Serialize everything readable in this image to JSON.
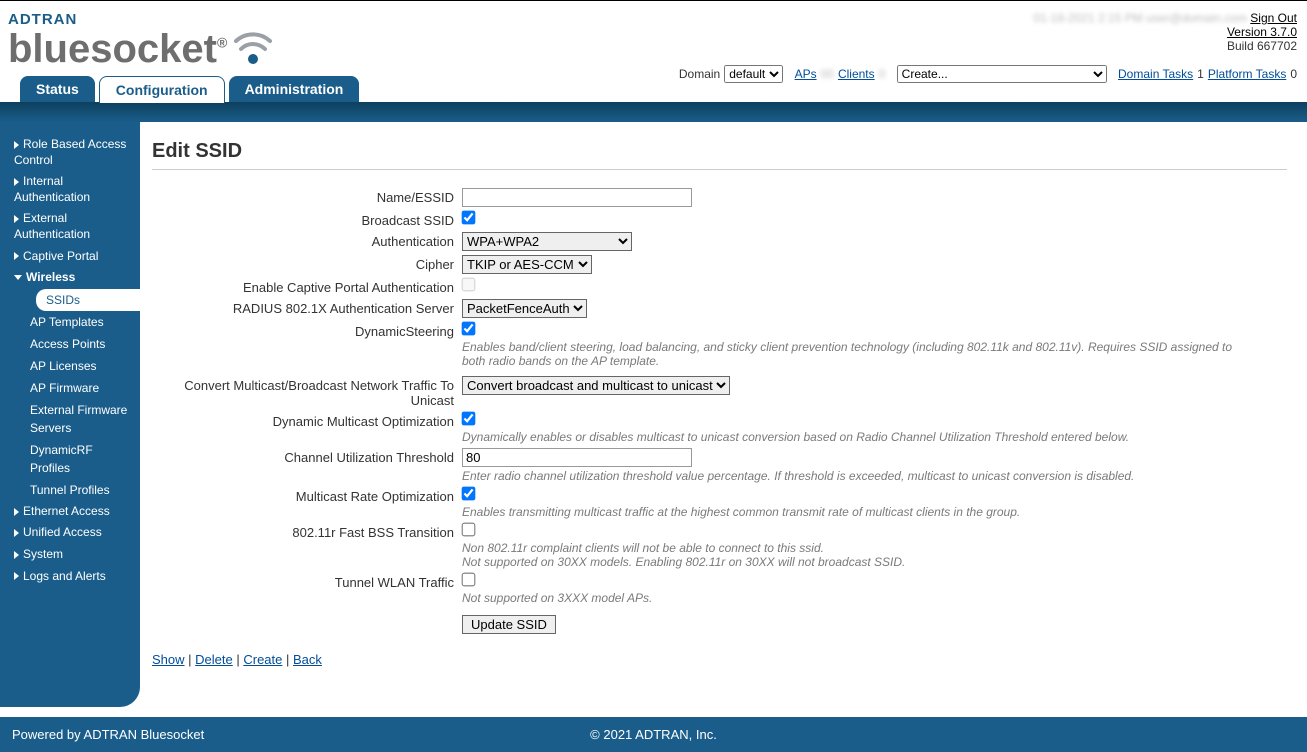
{
  "brand": {
    "line1": "ADTRAN",
    "line2": "bluesocket"
  },
  "top_right": {
    "obscured1": "01-18-2021 2:15 PM",
    "obscured2": "user@domain.com",
    "signout": "Sign Out",
    "version": "Version 3.7.0",
    "build": "Build 667702"
  },
  "subbar": {
    "domain_label": "Domain",
    "domain_value": "default",
    "aps_label": "APs",
    "aps_count": "",
    "clients_label": "Clients",
    "clients_count": "",
    "create_value": "Create...",
    "domain_tasks_label": "Domain Tasks",
    "domain_tasks_count": "1",
    "platform_tasks_label": "Platform Tasks",
    "platform_tasks_count": "0"
  },
  "tabs": {
    "status": "Status",
    "configuration": "Configuration",
    "administration": "Administration"
  },
  "sidebar": {
    "role": "Role Based Access Control",
    "internal": "Internal Authentication",
    "external": "External Authentication",
    "captive": "Captive Portal",
    "wireless": "Wireless",
    "wireless_items": {
      "ssids": "SSIDs",
      "ap_templates": "AP Templates",
      "access_points": "Access Points",
      "ap_licenses": "AP Licenses",
      "ap_firmware": "AP Firmware",
      "ext_fw": "External Firmware Servers",
      "dynrf": "DynamicRF Profiles",
      "tunnel": "Tunnel Profiles"
    },
    "ethernet": "Ethernet Access",
    "unified": "Unified Access",
    "system": "System",
    "logs": "Logs and Alerts"
  },
  "page": {
    "title": "Edit SSID",
    "labels": {
      "name": "Name/ESSID",
      "broadcast": "Broadcast SSID",
      "auth": "Authentication",
      "cipher": "Cipher",
      "captive": "Enable Captive Portal Authentication",
      "radius": "RADIUS 802.1X Authentication Server",
      "steer": "DynamicSteering",
      "mcast": "Convert Multicast/Broadcast Network Traffic To Unicast",
      "dmo": "Dynamic Multicast Optimization",
      "cut": "Channel Utilization Threshold",
      "mro": "Multicast Rate Optimization",
      "fbss": "802.11r Fast BSS Transition",
      "tunnel": "Tunnel WLAN Traffic"
    },
    "values": {
      "name_placeholder": "",
      "broadcast": true,
      "auth": "WPA+WPA2",
      "cipher": "TKIP or AES-CCM",
      "captive": false,
      "radius": "PacketFenceAuth",
      "steer": true,
      "mcast": "Convert broadcast and multicast to unicast",
      "dmo": true,
      "cut": "80",
      "mro": true,
      "fbss": false,
      "tunnel": false
    },
    "help": {
      "steer": "Enables band/client steering, load balancing, and sticky client prevention technology (including 802.11k and 802.11v). Requires SSID assigned to both radio bands on the AP template.",
      "dmo": "Dynamically enables or disables multicast to unicast conversion based on Radio Channel Utilization Threshold entered below.",
      "cut": "Enter radio channel utilization threshold value percentage. If threshold is exceeded, multicast to unicast conversion is disabled.",
      "mro": "Enables transmitting multicast traffic at the highest common transmit rate of multicast clients in the group.",
      "fbss1": "Non 802.11r complaint clients will not be able to connect to this ssid.",
      "fbss2": "Not supported on 30XX models. Enabling 802.11r on 30XX will not broadcast SSID.",
      "tunnel": "Not supported on 3XXX model APs."
    },
    "button": "Update SSID",
    "actions": {
      "show": "Show",
      "delete": "Delete",
      "create": "Create",
      "back": "Back"
    }
  },
  "footer": {
    "left": "Powered by ADTRAN Bluesocket",
    "center": "© 2021 ADTRAN, Inc."
  }
}
